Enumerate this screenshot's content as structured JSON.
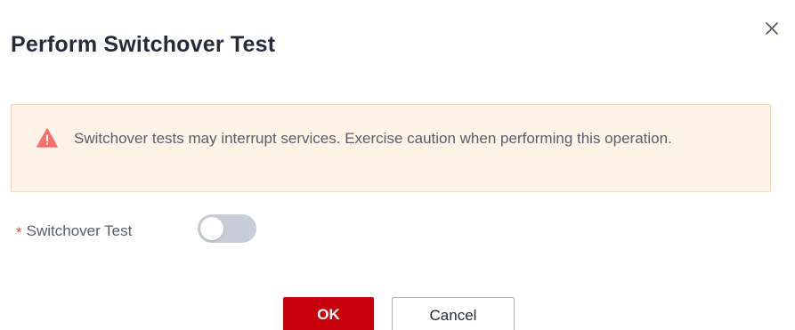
{
  "dialog": {
    "title": "Perform Switchover Test",
    "close_icon": "close-icon"
  },
  "alert": {
    "icon": "warning-icon",
    "text": "Switchover tests may interrupt services. Exercise caution when performing this operation.",
    "color_background": "#fff3e8",
    "color_icon": "#f66f6a"
  },
  "field": {
    "required_mark": "*",
    "label": "Switchover Test",
    "toggle_state": "off"
  },
  "buttons": {
    "ok_label": "OK",
    "cancel_label": "Cancel",
    "accent_color": "#c7000b"
  }
}
